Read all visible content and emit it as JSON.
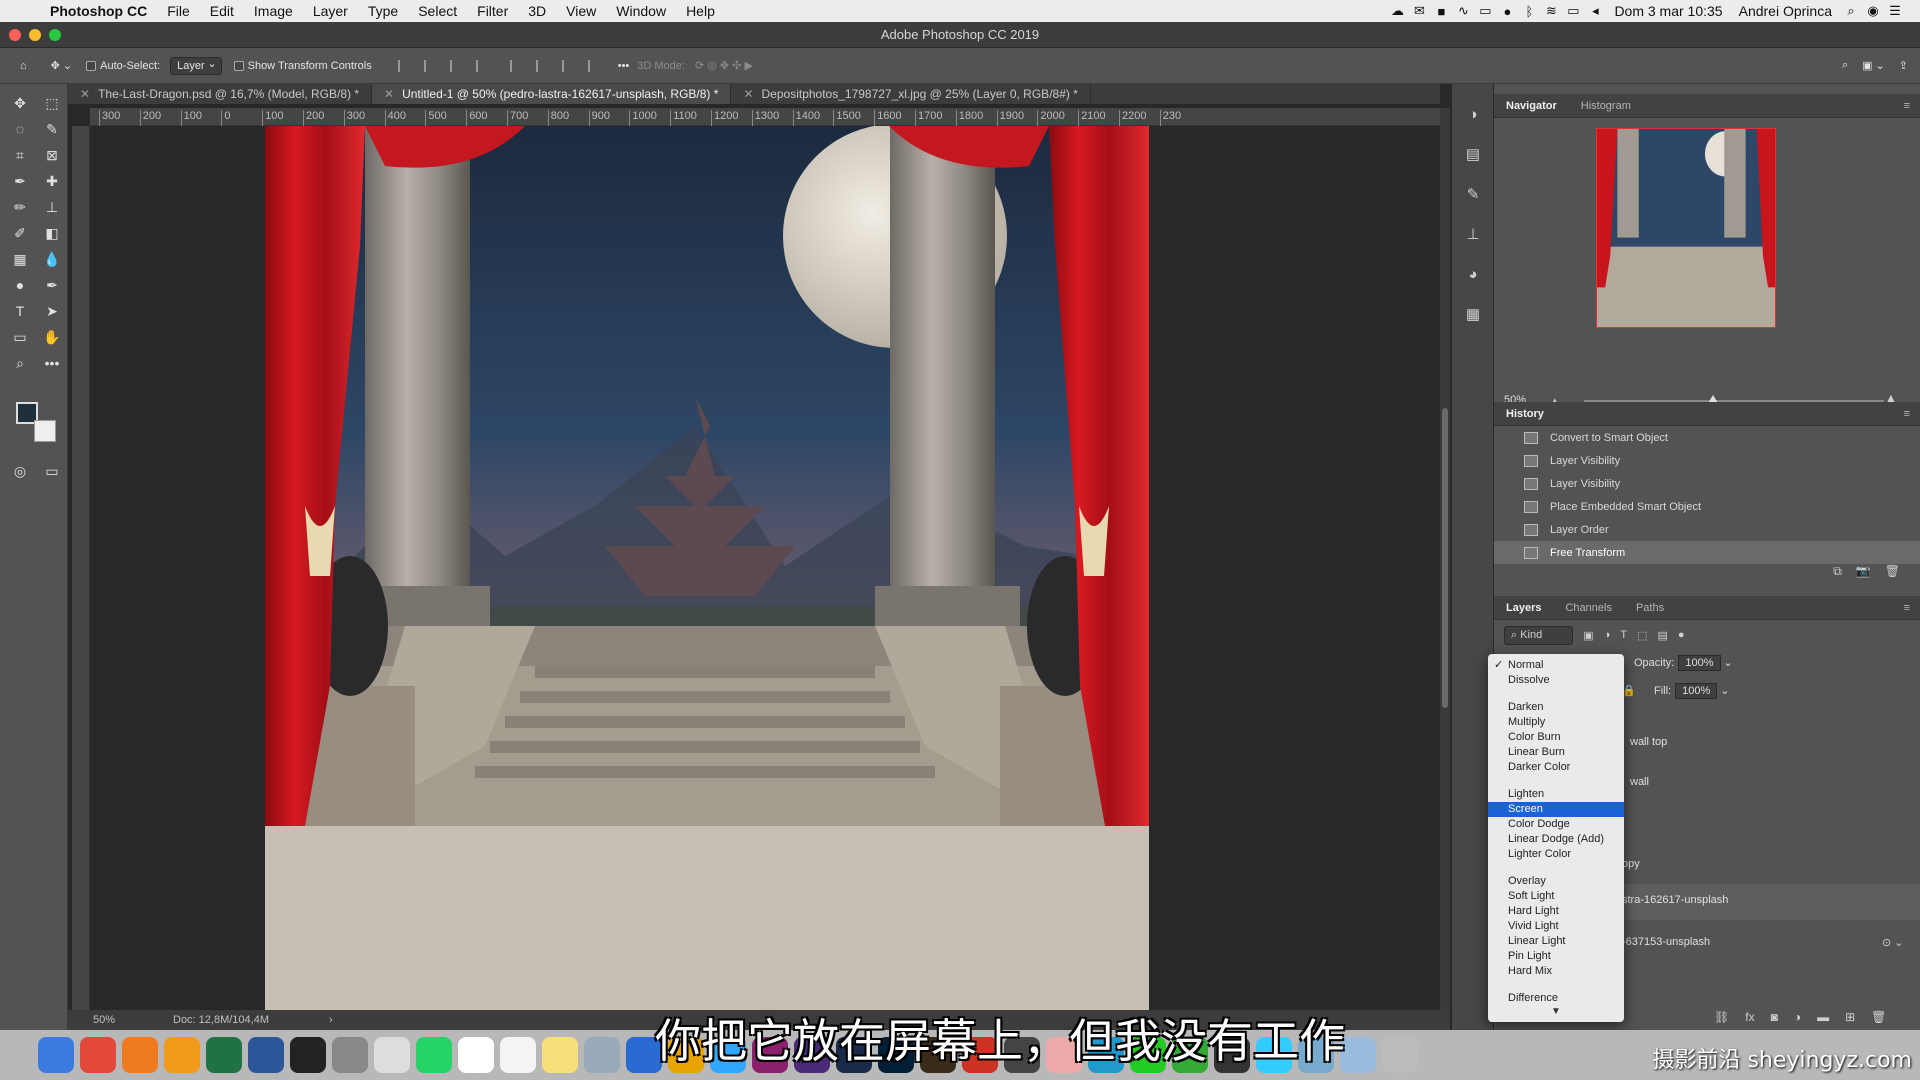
{
  "menubar": {
    "app_name": "Photoshop CC",
    "menus": [
      "File",
      "Edit",
      "Image",
      "Layer",
      "Type",
      "Select",
      "Filter",
      "3D",
      "View",
      "Window",
      "Help"
    ],
    "clock": "Dom 3 mar  10:35",
    "user": "Andrei Oprinca"
  },
  "window": {
    "title": "Adobe Photoshop CC 2019"
  },
  "options": {
    "auto_select_label": "Auto-Select:",
    "auto_select_value": "Layer",
    "transform_label": "Show Transform Controls",
    "mode3d_label": "3D Mode:"
  },
  "tabs": [
    "The-Last-Dragon.psd @ 16,7% (Model, RGB/8) *",
    "Untitled-1 @ 50% (pedro-lastra-162617-unsplash, RGB/8) *",
    "Depositphotos_1798727_xl.jpg @ 25% (Layer 0, RGB/8#) *"
  ],
  "ruler_ticks": [
    "300",
    "200",
    "100",
    "0",
    "100",
    "200",
    "300",
    "400",
    "500",
    "600",
    "700",
    "800",
    "900",
    "1000",
    "1100",
    "1200",
    "1300",
    "1400",
    "1500",
    "1600",
    "1700",
    "1800",
    "1900",
    "2000",
    "2100",
    "2200",
    "230"
  ],
  "status": {
    "zoom": "50%",
    "doc": "Doc: 12,8M/104,4M"
  },
  "navigator": {
    "tabs": [
      "Navigator",
      "Histogram"
    ],
    "zoom": "50%"
  },
  "history": {
    "title": "History",
    "items": [
      "Convert to Smart Object",
      "Layer Visibility",
      "Layer Visibility",
      "Place Embedded Smart Object",
      "Layer Order",
      "Free Transform"
    ],
    "active_index": 5
  },
  "layers": {
    "tabs": [
      "Layers",
      "Channels",
      "Paths"
    ],
    "kind": "Kind",
    "opacity_label": "Opacity:",
    "opacity_value": "100%",
    "fill_label": "Fill:",
    "fill_value": "100%",
    "rows": [
      "wall top",
      "wall",
      "opy",
      "stra-162617-unsplash",
      "-637153-unsplash"
    ]
  },
  "blend_modes": {
    "groups": [
      [
        "Normal",
        "Dissolve"
      ],
      [
        "Darken",
        "Multiply",
        "Color Burn",
        "Linear Burn",
        "Darker Color"
      ],
      [
        "Lighten",
        "Screen",
        "Color Dodge",
        "Linear Dodge (Add)",
        "Lighter Color"
      ],
      [
        "Overlay",
        "Soft Light",
        "Hard Light",
        "Vivid Light",
        "Linear Light",
        "Pin Light",
        "Hard Mix"
      ],
      [
        "Difference"
      ]
    ],
    "checked": "Normal",
    "highlighted": "Screen"
  },
  "subtitle": "你把它放在屏幕上，但我没有工作",
  "watermark": "摄影前沿 sheyingyz.com",
  "colors": {
    "accent": "#1a63d6",
    "curtain": "#c8141c",
    "panel_bg": "#535353"
  }
}
